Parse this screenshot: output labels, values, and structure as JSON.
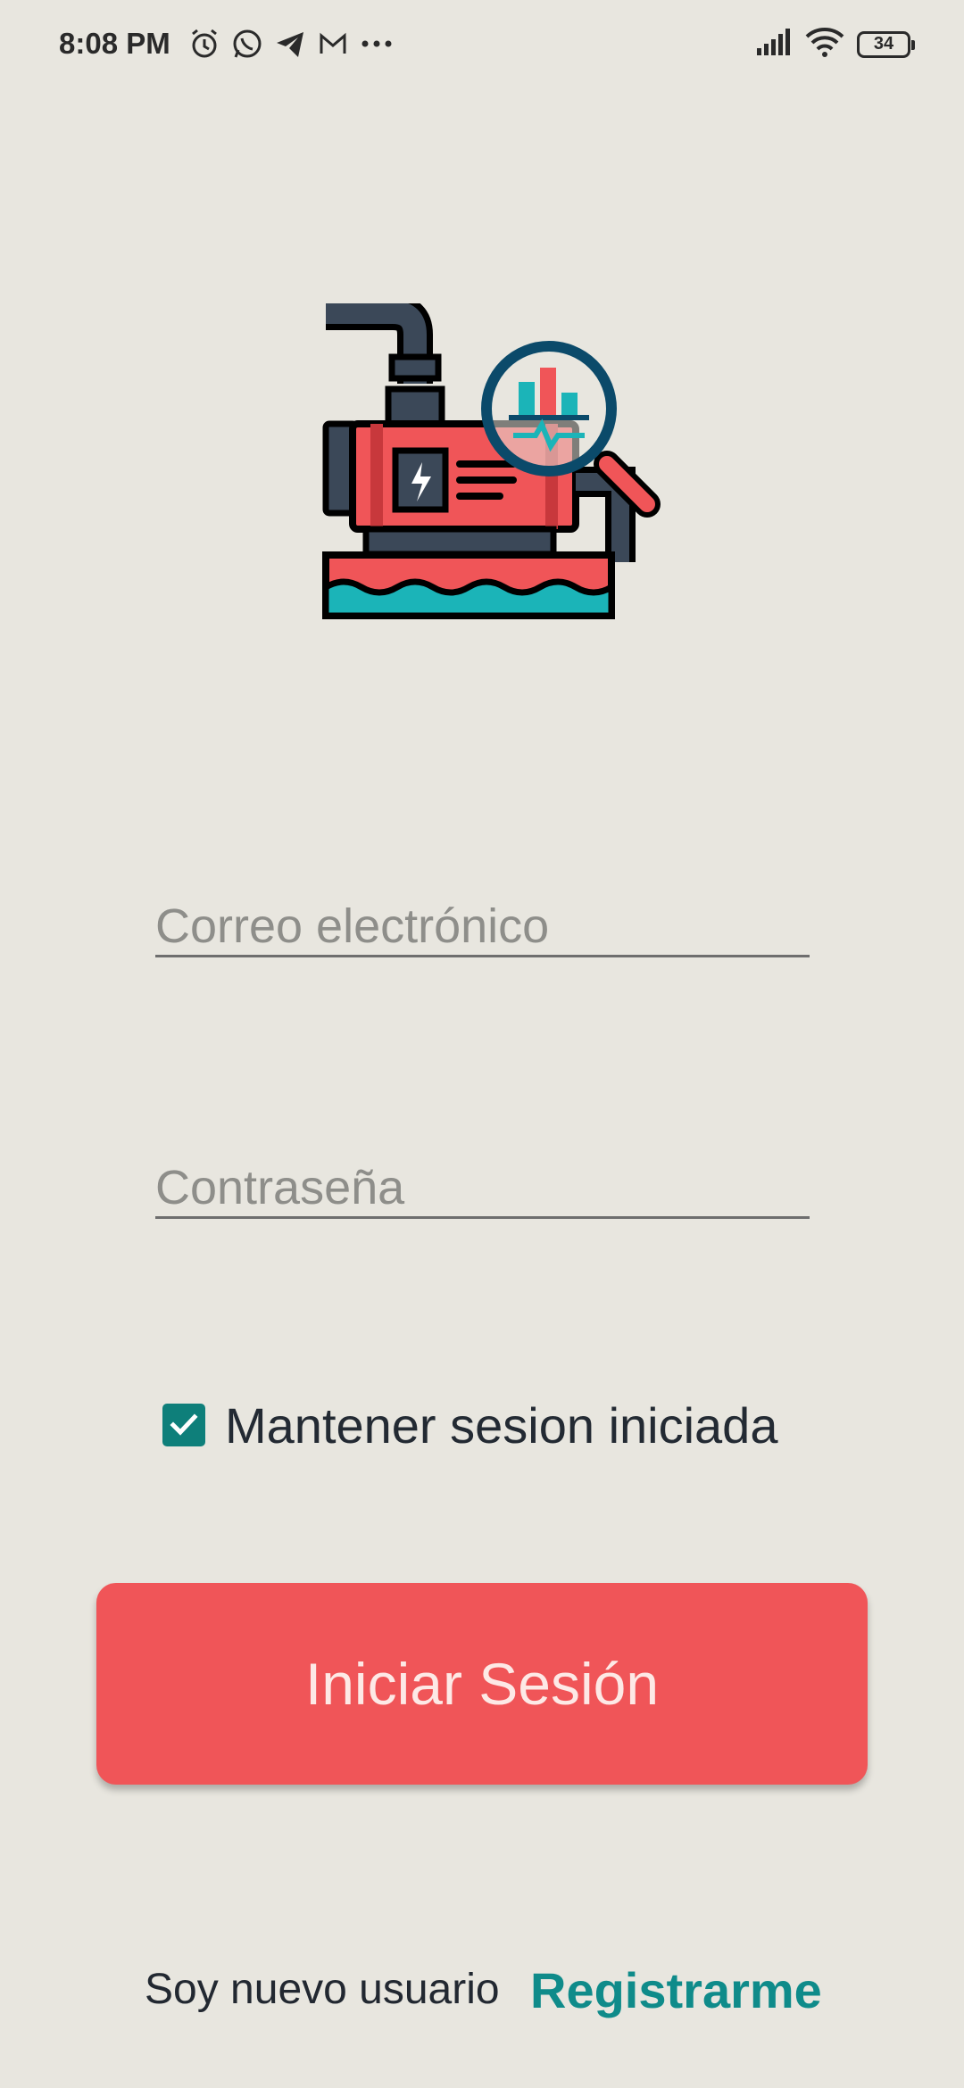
{
  "status_bar": {
    "time": "8:08 PM",
    "battery": "34",
    "icons_left": [
      "alarm-icon",
      "whatsapp-icon",
      "telegram-icon",
      "gmail-icon",
      "more-dots-icon"
    ],
    "icons_right": [
      "signal-icon",
      "wifi-icon",
      "battery-icon"
    ]
  },
  "logo": {
    "icon": "water-pump-monitor-icon"
  },
  "form": {
    "email_placeholder": "Correo electrónico",
    "password_placeholder": "Contraseña",
    "remember_label": "Mantener sesion iniciada",
    "remember_checked": true,
    "login_label": "Iniciar Sesión"
  },
  "footer": {
    "new_user_text": "Soy nuevo usuario",
    "register_label": "Registrarme"
  },
  "colors": {
    "background": "#e8e6df",
    "accent": "#f05558",
    "teal": "#0f8b8a"
  }
}
